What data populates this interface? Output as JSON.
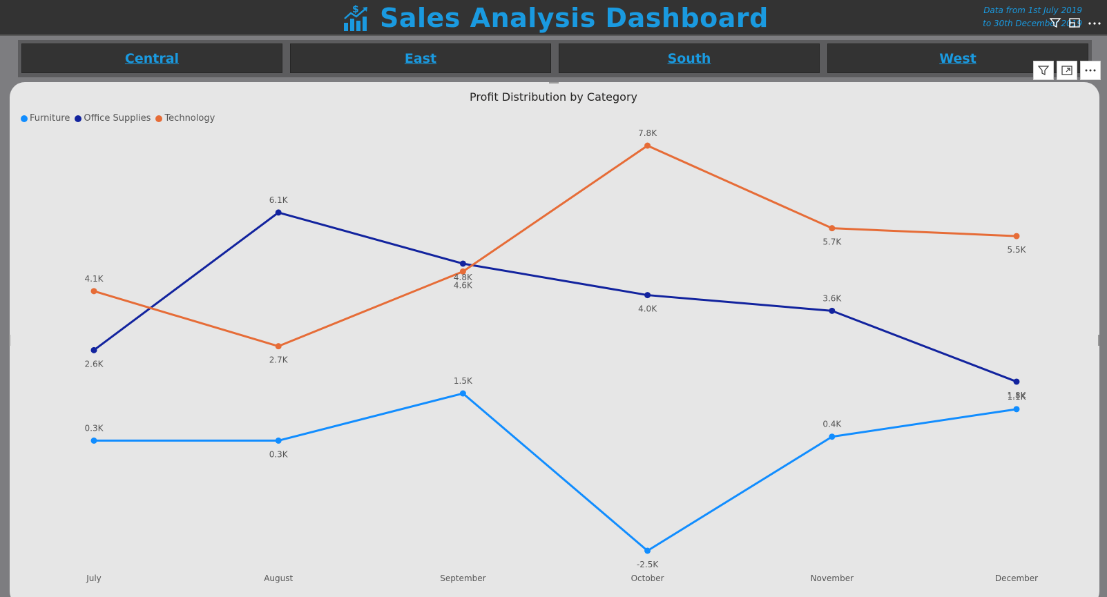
{
  "header": {
    "title": "Sales Analysis Dashboard",
    "date_note_line1": "Data from 1st July 2019",
    "date_note_line2": "to 30th December 2019",
    "accent_color": "#1a9ae0",
    "logo_icon": "sales-chart-dollar-icon",
    "tools": [
      "filter-icon",
      "focus-mode-icon",
      "more-options-icon"
    ]
  },
  "tabs": [
    {
      "label": "Central"
    },
    {
      "label": "East"
    },
    {
      "label": "South"
    },
    {
      "label": "West"
    }
  ],
  "visual_toolbar": [
    "filter-icon",
    "focus-mode-icon",
    "more-options-icon"
  ],
  "chart_data": {
    "type": "line",
    "title": "Profit Distribution by Category",
    "xlabel": "",
    "ylabel": "",
    "categories": [
      "July",
      "August",
      "September",
      "October",
      "November",
      "December"
    ],
    "series": [
      {
        "name": "Furniture",
        "color": "#118dff",
        "values": [
          0.3,
          0.3,
          1.5,
          -2.5,
          0.4,
          1.1
        ],
        "labels": [
          "0.3K",
          "0.3K",
          "1.5K",
          "-2.5K",
          "0.4K",
          "1.1K"
        ]
      },
      {
        "name": "Office Supplies",
        "color": "#12239e",
        "values": [
          2.6,
          6.1,
          4.8,
          4.0,
          3.6,
          1.8
        ],
        "labels": [
          "2.6K",
          "6.1K",
          "4.8K",
          "4.0K",
          "3.6K",
          "1.8K"
        ]
      },
      {
        "name": "Technology",
        "color": "#e66c37",
        "values": [
          4.1,
          2.7,
          4.6,
          7.8,
          5.7,
          5.5
        ],
        "labels": [
          "4.1K",
          "2.7K",
          "4.6K",
          "7.8K",
          "5.7K",
          "5.5K"
        ]
      }
    ],
    "units": "K",
    "grid": false,
    "legend_position": "top-left"
  }
}
